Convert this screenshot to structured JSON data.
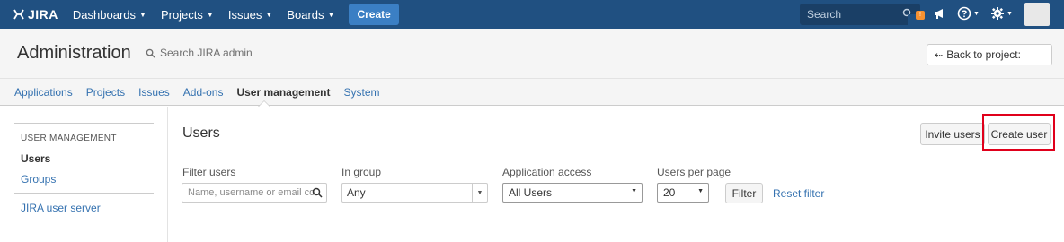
{
  "topnav": {
    "logo": "JIRA",
    "items": [
      {
        "label": "Dashboards"
      },
      {
        "label": "Projects"
      },
      {
        "label": "Issues"
      },
      {
        "label": "Boards"
      }
    ],
    "create_label": "Create",
    "search_placeholder": "Search",
    "icons": [
      "megaphone-icon",
      "help-icon",
      "gear-icon"
    ]
  },
  "admin": {
    "title": "Administration",
    "search_label": "Search JIRA admin",
    "back_label": "Back to project:"
  },
  "tabs": [
    {
      "label": "Applications"
    },
    {
      "label": "Projects"
    },
    {
      "label": "Issues"
    },
    {
      "label": "Add-ons"
    },
    {
      "label": "User management",
      "active": true
    },
    {
      "label": "System"
    }
  ],
  "sidebar": {
    "heading": "USER MANAGEMENT",
    "items": [
      {
        "label": "Users",
        "active": true
      },
      {
        "label": "Groups"
      },
      {
        "label": "JIRA user server"
      }
    ]
  },
  "main": {
    "title": "Users",
    "invite_label": "Invite users",
    "create_user_label": "Create user",
    "filters": {
      "filter_users_label": "Filter users",
      "filter_users_placeholder": "Name, username or email co",
      "in_group_label": "In group",
      "in_group_value": "Any",
      "app_access_label": "Application access",
      "app_access_value": "All Users",
      "per_page_label": "Users per page",
      "per_page_value": "20",
      "filter_button": "Filter",
      "reset_link": "Reset filter"
    }
  },
  "colors": {
    "nav_bg": "#205081",
    "create_bg": "#3b7fc4",
    "link": "#3572b0",
    "highlight": "#e0001b"
  }
}
